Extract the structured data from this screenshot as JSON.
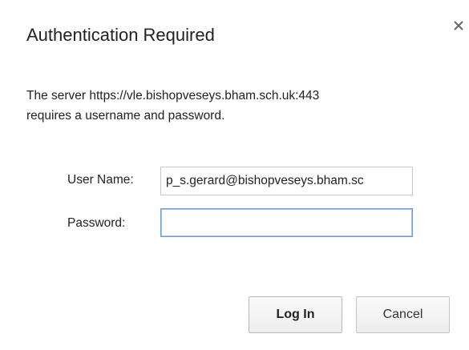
{
  "dialog": {
    "title": "Authentication Required",
    "close_icon": "close-icon",
    "message_line1": "The server https://vle.bishopveseys.bham.sch.uk:443",
    "message_line2": "requires a username and password."
  },
  "form": {
    "username_label": "User Name:",
    "username_value": "p_s.gerard@bishopveseys.bham.sc",
    "password_label": "Password:",
    "password_value": ""
  },
  "buttons": {
    "login_label": "Log In",
    "cancel_label": "Cancel"
  },
  "colors": {
    "focus_border": "#6f9ad6",
    "text": "#222222"
  }
}
